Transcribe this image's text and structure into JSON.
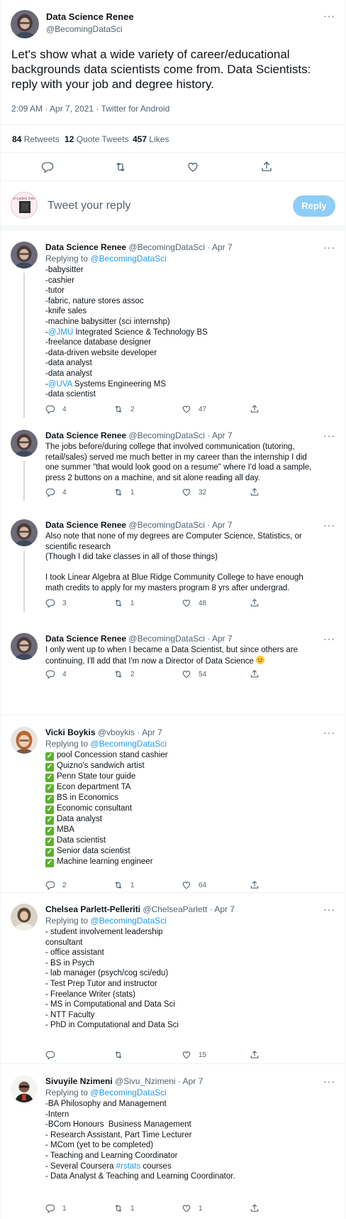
{
  "main_tweet": {
    "name": "Data Science Renee",
    "handle": "@BecomingDataSci",
    "text_lines": [
      "Let's show what a wide variety of career/educational",
      "backgrounds data scientists come from. Data Scientists:",
      "reply with your job and degree history."
    ],
    "time": "2:09 AM",
    "date": "Apr 7, 2021",
    "source": "Twitter for Android",
    "meta_sep": "·",
    "stats": {
      "retweets_count": "84",
      "retweets_label": "Retweets",
      "quotes_count": "12",
      "quotes_label": "Quote Tweets",
      "likes_count": "457",
      "likes_label": "Likes"
    },
    "more": "···"
  },
  "composer": {
    "avatar_caption": "R-Ladies Irvine",
    "placeholder": "Tweet your reply",
    "button": "Reply"
  },
  "replying_prefix": "Replying to",
  "replies": [
    {
      "name": "Data Science Renee",
      "handle": "@BecomingDataSci",
      "date": "Apr 7",
      "replying_to": "@BecomingDataSci",
      "lines": [
        [
          {
            "t": "-babysitter"
          }
        ],
        [
          {
            "t": "-cashier"
          }
        ],
        [
          {
            "t": "-tutor"
          }
        ],
        [
          {
            "t": "-fabric, nature stores assoc"
          }
        ],
        [
          {
            "t": "-knife sales"
          }
        ],
        [
          {
            "t": "-machine babysitter (sci internshp)"
          }
        ],
        [
          {
            "t": "-"
          },
          {
            "t": "@JMU",
            "link": true
          },
          {
            "t": " Integrated Science & Technology BS"
          }
        ],
        [
          {
            "t": "-freelance database designer"
          }
        ],
        [
          {
            "t": "-data-driven website developer"
          }
        ],
        [
          {
            "t": "-data analyst"
          }
        ],
        [
          {
            "t": "-data analyst"
          }
        ],
        [
          {
            "t": "-"
          },
          {
            "t": "@UVA",
            "link": true
          },
          {
            "t": " Systems Engineering MS"
          }
        ],
        [
          {
            "t": "-data scientist"
          }
        ]
      ],
      "replies": "4",
      "retweets": "2",
      "likes": "47"
    },
    {
      "name": "Data Science Renee",
      "handle": "@BecomingDataSci",
      "date": "Apr 7",
      "lines": [
        [
          {
            "t": "The jobs before/during college that involved communication (tutoring,"
          }
        ],
        [
          {
            "t": "retail/sales) served me much better in my career than the internship I did"
          }
        ],
        [
          {
            "t": "one summer \"that would look good on a resume\" where I'd load a sample,"
          }
        ],
        [
          {
            "t": "press 2 buttons on a machine, and sit alone reading all day."
          }
        ]
      ],
      "replies": "4",
      "retweets": "1",
      "likes": "32"
    },
    {
      "name": "Data Science Renee",
      "handle": "@BecomingDataSci",
      "date": "Apr 7",
      "lines": [
        [
          {
            "t": "Also note that none of my degrees are Computer Science, Statistics, or"
          }
        ],
        [
          {
            "t": "scientific research"
          }
        ],
        [
          {
            "t": "(Though I did take classes in all of those things)"
          }
        ],
        [
          {
            "t": ""
          }
        ],
        [
          {
            "t": "I took Linear Algebra at Blue Ridge Community College to have enough"
          }
        ],
        [
          {
            "t": "math credits to apply for my masters program 8 yrs after undergrad."
          }
        ]
      ],
      "replies": "3",
      "retweets": "1",
      "likes": "48"
    },
    {
      "name": "Data Science Renee",
      "handle": "@BecomingDataSci",
      "date": "Apr 7",
      "lines": [
        [
          {
            "t": "I only went up to when I became a Data Scientist, but since others are"
          }
        ],
        [
          {
            "t": "continuing, I'll add that I'm now a Director of Data Science "
          },
          {
            "emoji": "smiling-face-emoji"
          }
        ]
      ],
      "replies": "4",
      "retweets": "2",
      "likes": "54"
    },
    {
      "name": "Vicki Boykis",
      "handle": "@vboykis",
      "date": "Apr 7",
      "replying_to": "@BecomingDataSci",
      "lines": [
        [
          {
            "check": true
          },
          {
            "t": "pool Concession stand cashier"
          }
        ],
        [
          {
            "check": true
          },
          {
            "t": "Quizno's sandwich artist"
          }
        ],
        [
          {
            "check": true
          },
          {
            "t": "Penn State tour guide"
          }
        ],
        [
          {
            "check": true
          },
          {
            "t": "Econ department TA"
          }
        ],
        [
          {
            "check": true
          },
          {
            "t": "BS in Economics"
          }
        ],
        [
          {
            "check": true
          },
          {
            "t": "Economic consultant"
          }
        ],
        [
          {
            "check": true
          },
          {
            "t": "Data analyst"
          }
        ],
        [
          {
            "check": true
          },
          {
            "t": "MBA"
          }
        ],
        [
          {
            "check": true
          },
          {
            "t": "Data scientist"
          }
        ],
        [
          {
            "check": true
          },
          {
            "t": "Senior data scientist"
          }
        ],
        [
          {
            "check": true
          },
          {
            "t": "Machine learning engineer"
          }
        ]
      ],
      "replies": "2",
      "retweets": "1",
      "likes": "64"
    },
    {
      "name": "Chelsea Parlett-Pelleriti",
      "handle": "@ChelseaParlett",
      "date": "Apr 7",
      "replying_to": "@BecomingDataSci",
      "lines": [
        [
          {
            "t": "- student involvement leadership"
          }
        ],
        [
          {
            "t": "consultant"
          }
        ],
        [
          {
            "t": "- office assistant"
          }
        ],
        [
          {
            "t": "- BS in Psych"
          }
        ],
        [
          {
            "t": "- lab manager (psych/cog sci/edu)"
          }
        ],
        [
          {
            "t": "- Test Prep Tutor and instructor"
          }
        ],
        [
          {
            "t": "- Freelance Writer (stats)"
          }
        ],
        [
          {
            "t": "- MS in Computational and Data Sci"
          }
        ],
        [
          {
            "t": "- NTT Faculty"
          }
        ],
        [
          {
            "t": "- PhD in Computational and Data Sci"
          }
        ]
      ],
      "replies": "",
      "retweets": "",
      "likes": "15"
    },
    {
      "name": "Sivuyile Nzimeni",
      "handle": "@Sivu_Nzimeni",
      "date": "Apr 7",
      "replying_to": "@BecomingDataSci",
      "lines": [
        [
          {
            "t": "-BA Philosophy and Management"
          }
        ],
        [
          {
            "t": "-Intern"
          }
        ],
        [
          {
            "t": "-BCom Honours  Business Management"
          }
        ],
        [
          {
            "t": "- Research Assistant, Part Time Lecturer"
          }
        ],
        [
          {
            "t": "- MCom (yet to be completed)"
          }
        ],
        [
          {
            "t": "- Teaching and Learning Coordinator"
          }
        ],
        [
          {
            "t": "- Several Coursera "
          },
          {
            "t": "#rstats",
            "link": true
          },
          {
            "t": " courses"
          }
        ],
        [
          {
            "t": "- Data Analyst & Teaching and Learning Coordinator."
          }
        ]
      ],
      "replies": "1",
      "retweets": "1",
      "likes": "1"
    }
  ]
}
